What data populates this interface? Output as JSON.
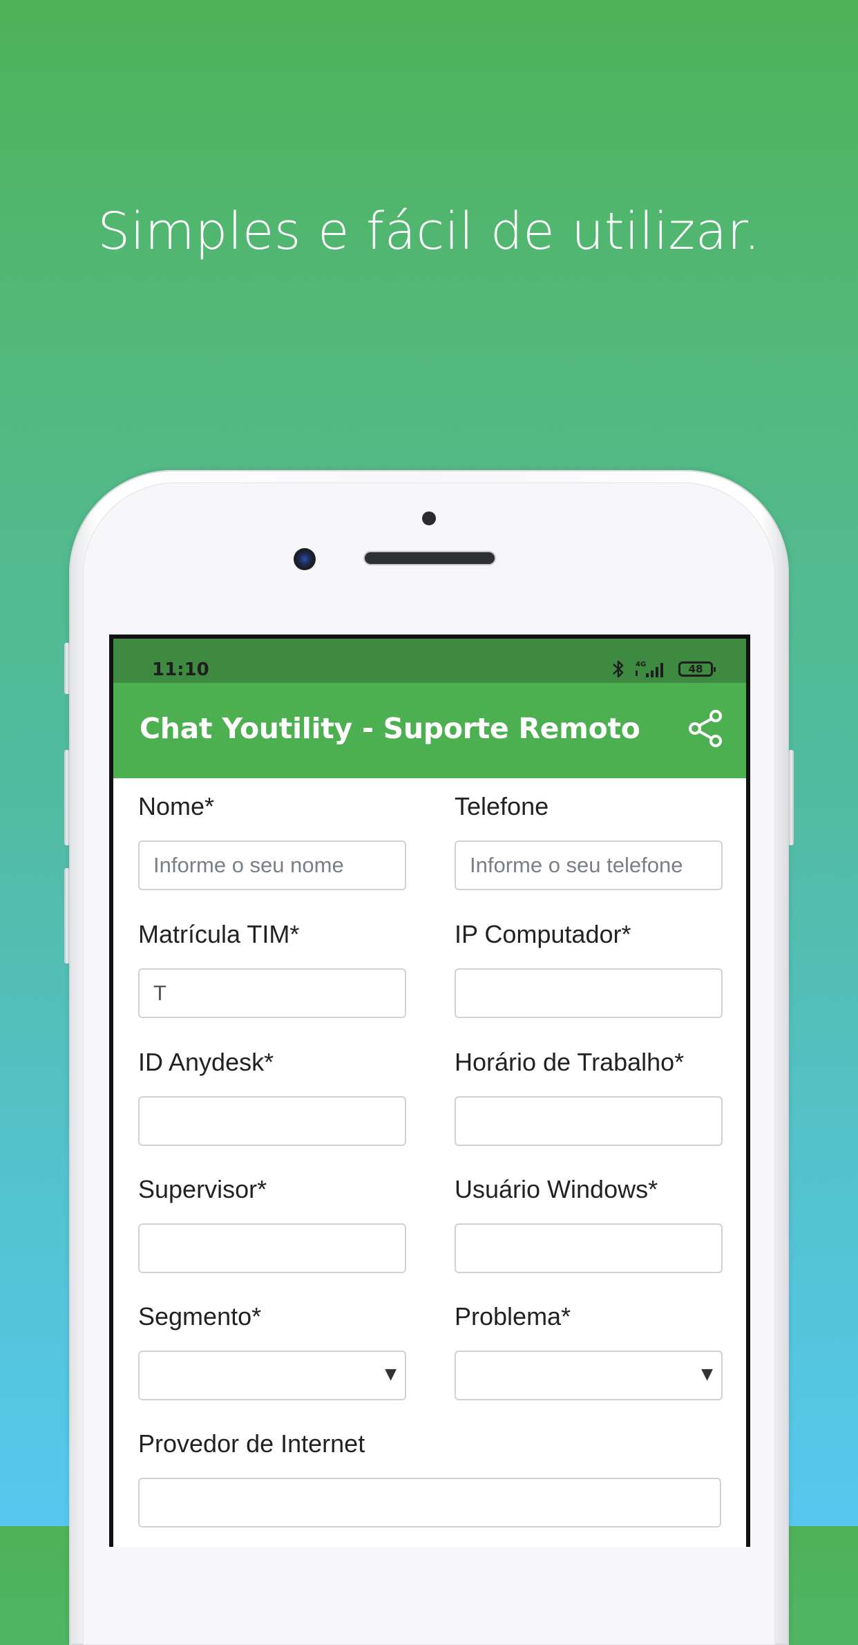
{
  "headline": "Simples e fácil de utilizar.",
  "status_bar": {
    "time": "11:10",
    "network": "4G",
    "battery": "48"
  },
  "app_bar": {
    "title": "Chat Youtility - Suporte Remoto",
    "share_icon": "share-icon"
  },
  "form": {
    "nome": {
      "label": "Nome*",
      "placeholder": "Informe o seu nome",
      "value": ""
    },
    "telefone": {
      "label": "Telefone",
      "placeholder": "Informe o seu telefone",
      "value": ""
    },
    "matricula": {
      "label": "Matrícula TIM*",
      "placeholder": "",
      "value": "T"
    },
    "ip": {
      "label": "IP Computador*",
      "placeholder": "",
      "value": ""
    },
    "anydesk": {
      "label": "ID Anydesk*",
      "placeholder": "",
      "value": ""
    },
    "horario": {
      "label": "Horário de Trabalho*",
      "placeholder": "",
      "value": ""
    },
    "supervisor": {
      "label": "Supervisor*",
      "placeholder": "",
      "value": ""
    },
    "usuario": {
      "label": "Usuário Windows*",
      "placeholder": "",
      "value": ""
    },
    "segmento": {
      "label": "Segmento*",
      "selected": "",
      "caret": "▼"
    },
    "problema": {
      "label": "Problema*",
      "selected": "",
      "caret": "▼"
    },
    "provedor": {
      "label": "Provedor de Internet",
      "placeholder": "",
      "value": ""
    }
  },
  "colors": {
    "app_bar": "#4caf50",
    "status_bar": "#3e8a40",
    "bg_top": "#4fb258",
    "bg_bottom": "#56c8ef"
  }
}
